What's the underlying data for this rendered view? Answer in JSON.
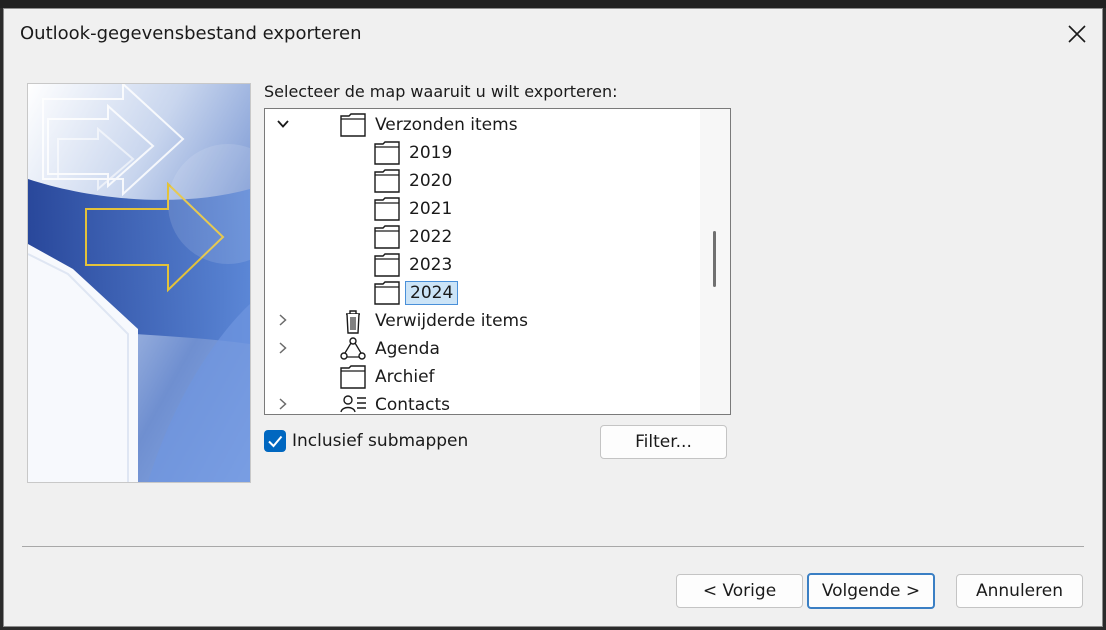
{
  "window": {
    "title": "Outlook-gegevensbestand exporteren"
  },
  "prompt": "Selecteer de map waaruit u wilt exporteren:",
  "tree": {
    "items": [
      {
        "label": "Verzonden items",
        "icon": "folder",
        "expander": "expanded",
        "selected": false
      },
      {
        "label": "2019",
        "icon": "folder",
        "expander": "none",
        "selected": false
      },
      {
        "label": "2020",
        "icon": "folder",
        "expander": "none",
        "selected": false
      },
      {
        "label": "2021",
        "icon": "folder",
        "expander": "none",
        "selected": false
      },
      {
        "label": "2022",
        "icon": "folder",
        "expander": "none",
        "selected": false
      },
      {
        "label": "2023",
        "icon": "folder",
        "expander": "none",
        "selected": false
      },
      {
        "label": "2024",
        "icon": "folder",
        "expander": "none",
        "selected": true
      },
      {
        "label": "Verwijderde items",
        "icon": "trash",
        "expander": "collapsed",
        "selected": false
      },
      {
        "label": "Agenda",
        "icon": "calendar",
        "expander": "collapsed",
        "selected": false
      },
      {
        "label": "Archief",
        "icon": "folder",
        "expander": "none",
        "selected": false
      },
      {
        "label": "Contacts",
        "icon": "contacts",
        "expander": "collapsed",
        "selected": false
      }
    ]
  },
  "include_subfolders": {
    "label": "Inclusief submappen",
    "checked": true
  },
  "buttons": {
    "filter": "Filter...",
    "back": "< Vorige",
    "next": "Volgende >",
    "cancel": "Annuleren"
  },
  "colors": {
    "accent": "#0067c0",
    "selection_bg": "#cce4f7",
    "dialog_bg": "#f0f0f0"
  }
}
